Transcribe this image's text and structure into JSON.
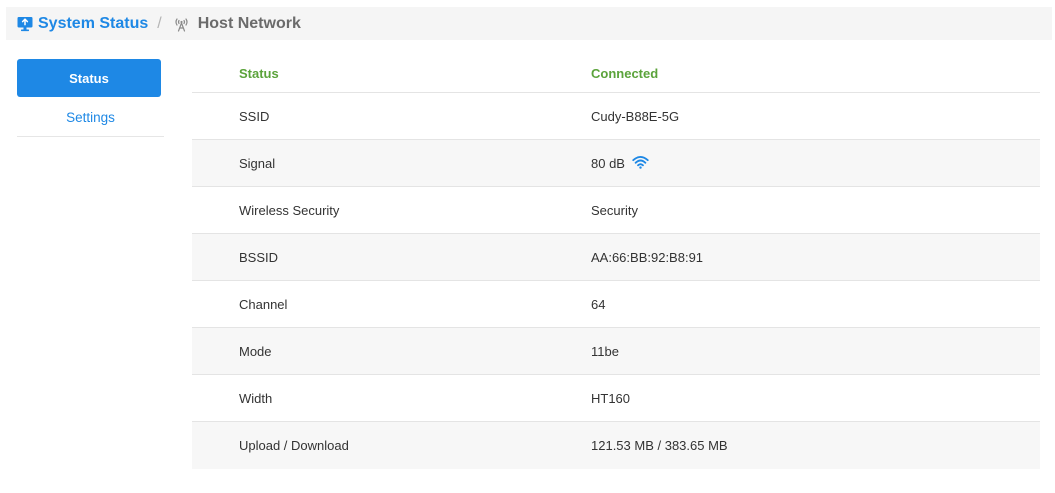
{
  "breadcrumb": {
    "section": "System Status",
    "separator": "/",
    "current": "Host Network"
  },
  "icons": {
    "section": "monitor-icon",
    "current": "antenna-icon",
    "signal": "wifi-signal-icon"
  },
  "colors": {
    "accent": "#1e88e5",
    "status_ok": "#5ba33b"
  },
  "sidebar": {
    "items": [
      {
        "label": "Status",
        "active": true
      },
      {
        "label": "Settings",
        "active": false
      }
    ]
  },
  "table": {
    "header": {
      "key": "Status",
      "value": "Connected"
    },
    "rows": [
      {
        "key": "SSID",
        "value": "Cudy-B88E-5G"
      },
      {
        "key": "Signal",
        "value": "80 dB"
      },
      {
        "key": "Wireless Security",
        "value": "Security"
      },
      {
        "key": "BSSID",
        "value": "AA:66:BB:92:B8:91"
      },
      {
        "key": "Channel",
        "value": "64"
      },
      {
        "key": "Mode",
        "value": "11be"
      },
      {
        "key": "Width",
        "value": "HT160"
      },
      {
        "key": "Upload / Download",
        "value": "121.53 MB / 383.65 MB"
      }
    ]
  }
}
